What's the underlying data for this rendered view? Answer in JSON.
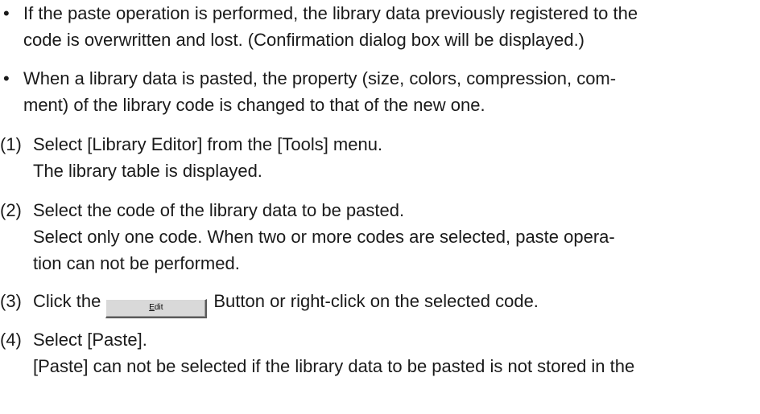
{
  "bullets": [
    {
      "marker": "•",
      "lines": [
        "If the paste operation is performed, the library data previously registered to the",
        "code is overwritten and lost. (Confirmation dialog box will be displayed.)"
      ]
    },
    {
      "marker": "•",
      "lines": [
        "When a library data is pasted, the property (size, colors, compression, com-",
        "ment) of the library code is changed to that of the new one."
      ]
    }
  ],
  "steps": [
    {
      "marker": "(1)",
      "lines": [
        "Select [Library Editor] from the [Tools] menu.",
        "The library table is displayed."
      ]
    },
    {
      "marker": "(2)",
      "lines": [
        "Select the code of the library data to be pasted.",
        "Select only one code. When two or more codes are selected, paste opera-",
        "tion can not be performed."
      ]
    },
    {
      "marker": "(3)",
      "before_button": "Click the",
      "button_label_first": "E",
      "button_label_rest": "dit",
      "after_button": "Button or right-click on the selected code."
    },
    {
      "marker": "(4)",
      "lines": [
        "Select [Paste].",
        "[Paste] can not be selected if the library data to be pasted is not stored in the"
      ]
    }
  ]
}
